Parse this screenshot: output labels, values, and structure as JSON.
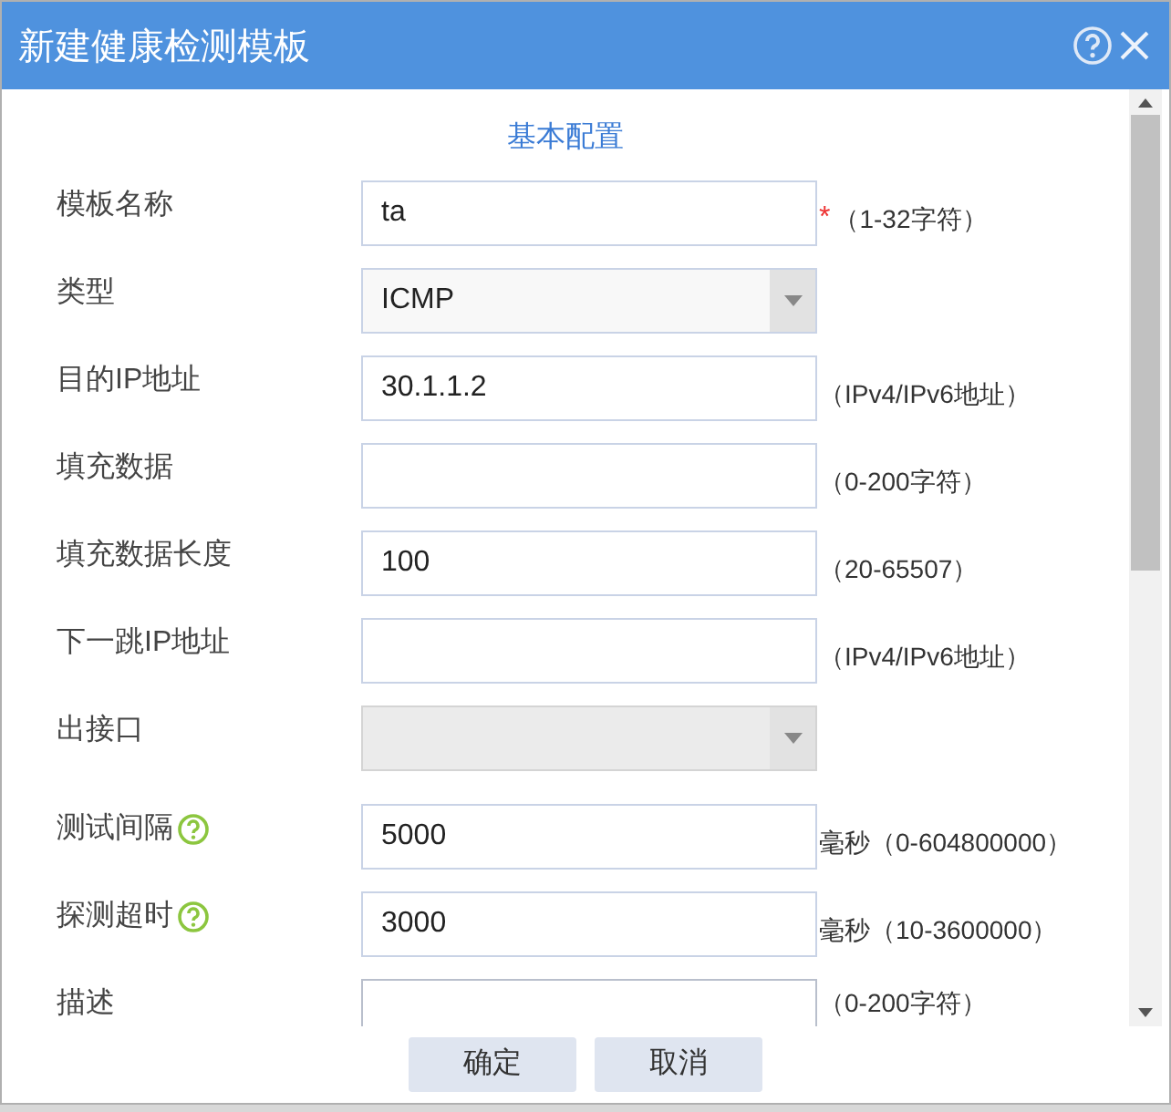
{
  "title": "新建健康检测模板",
  "section": "基本配置",
  "fields": [
    {
      "label": "模板名称",
      "kind": "text",
      "value": "ta",
      "required": true,
      "hint": "（1-32字符）"
    },
    {
      "label": "类型",
      "kind": "select",
      "value": "ICMP",
      "disabled": false
    },
    {
      "label": "目的IP地址",
      "kind": "text",
      "value": "30.1.1.2",
      "hint": "（IPv4/IPv6地址）"
    },
    {
      "label": "填充数据",
      "kind": "text",
      "hint": "（0-200字符）"
    },
    {
      "label": "填充数据长度",
      "kind": "text",
      "value": "100",
      "hint": "（20-65507）"
    },
    {
      "label": "下一跳IP地址",
      "kind": "text",
      "hint": "（IPv4/IPv6地址）"
    },
    {
      "label": "出接口",
      "kind": "select",
      "disabled": true
    },
    {
      "label": "测试间隔",
      "kind": "text",
      "value": "5000",
      "help": true,
      "hint": "毫秒（0-604800000）"
    },
    {
      "label": "探测超时",
      "kind": "text",
      "value": "3000",
      "help": true,
      "hint": "毫秒（10-3600000）"
    },
    {
      "label": "描述",
      "kind": "textarea",
      "hint": "（0-200字符）"
    }
  ],
  "required_mark": "*",
  "buttons": [
    "确定",
    "取消"
  ]
}
